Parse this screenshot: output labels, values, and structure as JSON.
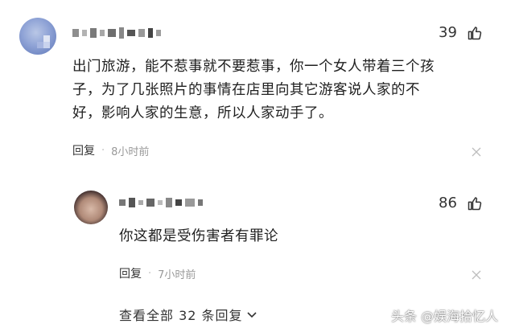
{
  "comment1": {
    "username": "",
    "likes": "39",
    "text_line1": "出门旅游，能不惹事就不要惹事，你一个女人带着三个孩",
    "text_line2": "子，为了几张照片的事情在店里向其它游客说人家的不",
    "text_line3": "好，影响人家的生意，所以人家动手了。",
    "reply_label": "回复",
    "separator": "·",
    "time": "8小时前",
    "like_icon": "thumbs-up-icon",
    "more_icon": "more-icon"
  },
  "reply1": {
    "username": "",
    "likes": "86",
    "text": "你这都是受伤害者有罪论",
    "reply_label": "回复",
    "separator": "·",
    "time": "7小时前",
    "like_icon": "thumbs-up-icon",
    "more_icon": "more-icon"
  },
  "view_all": {
    "label": "查看全部 32 条回复",
    "icon": "chevron-down-icon"
  },
  "watermark": "头条 @娱海拾忆人"
}
